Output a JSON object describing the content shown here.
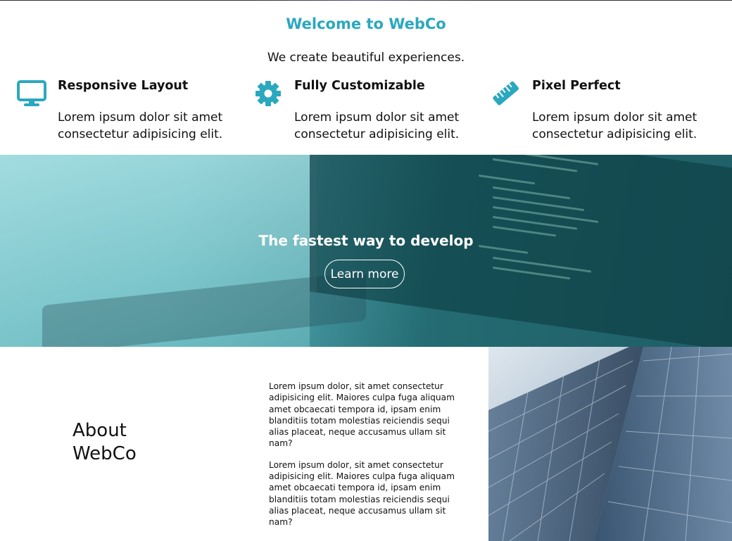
{
  "header": {
    "title": "Welcome to WebCo",
    "tagline": "We create beautiful experiences."
  },
  "features": [
    {
      "icon": "monitor-icon",
      "title": "Responsive Layout",
      "line1": "Lorem ipsum dolor sit amet",
      "line2": "consectetur adipisicing elit."
    },
    {
      "icon": "gear-icon",
      "title": "Fully Customizable",
      "line1": "Lorem ipsum dolor sit amet",
      "line2": "consectetur adipisicing elit."
    },
    {
      "icon": "ruler-icon",
      "title": "Pixel Perfect",
      "line1": "Lorem ipsum dolor sit amet",
      "line2": "consectetur adipisicing elit."
    }
  ],
  "hero": {
    "title": "The fastest way to develop",
    "button_label": "Learn more"
  },
  "about": {
    "title": "About WebCo",
    "paragraphs": [
      "Lorem ipsum dolor, sit amet consectetur adipisicing elit. Maiores culpa fuga aliquam amet obcaecati tempora id, ipsam enim blanditiis totam molestias reiciendis sequi alias placeat, neque accusamus ullam sit nam?",
      "Lorem ipsum dolor, sit amet consectetur adipisicing elit. Maiores culpa fuga aliquam amet obcaecati tempora id, ipsam enim blanditiis totam molestias reiciendis sequi alias placeat, neque accusamus ullam sit nam?"
    ]
  },
  "colors": {
    "accent": "#2aa8bf",
    "hero_overlay": "#1f6a72",
    "text": "#111111"
  }
}
